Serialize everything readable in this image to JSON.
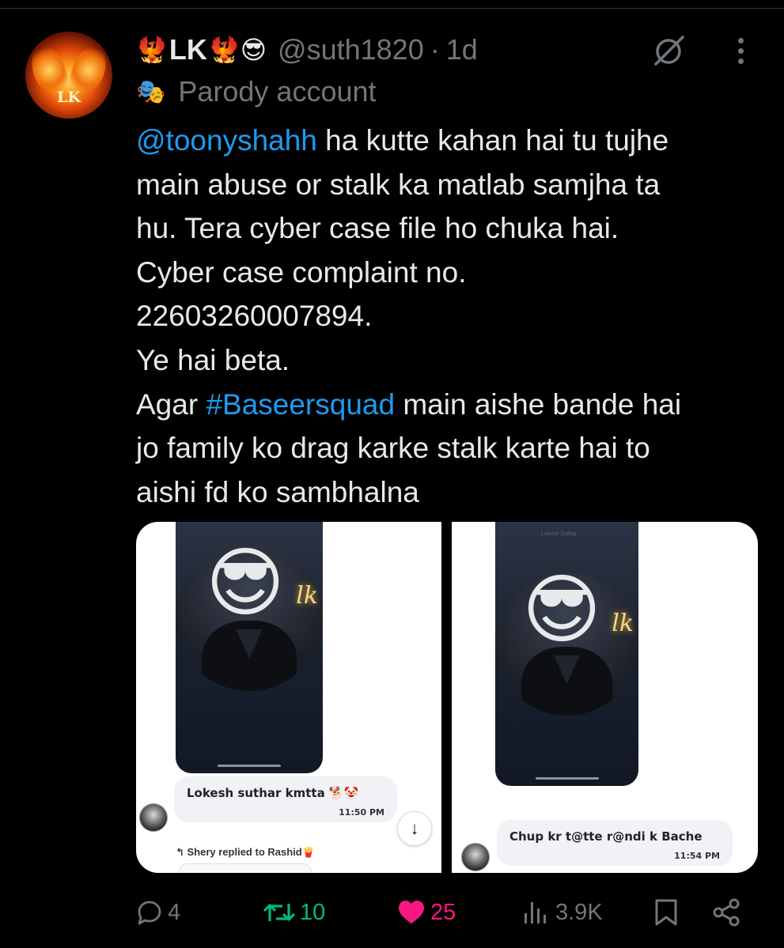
{
  "tweet": {
    "author": {
      "name": "LK",
      "name_prefix_emoji": "🐦‍🔥",
      "name_suffix_emojis": "🐦‍🔥😎",
      "handle": "@suth1820",
      "separator": "·",
      "time": "1d",
      "label_icon": "🎭",
      "label": "Parody account",
      "avatar_monogram": "LK"
    },
    "text": {
      "line1_mention": "@toonyshahh",
      "line1_rest": " ha kutte kahan hai tu tujhe",
      "line2": "main abuse or stalk ka matlab samjha ta",
      "line3": "hu. Tera cyber case file ho chuka hai.",
      "line4": "Cyber case complaint no.",
      "line5": "22603260007894.",
      "line6": "Ye hai beta.",
      "line7_pre": "Agar ",
      "line7_hashtag": "#Baseersquad",
      "line7_post": " main aishe bande hai",
      "line8": "jo family ko drag karke stalk karte hai to",
      "line9": "aishi fd ko sambhalna"
    },
    "media": {
      "image1": {
        "sticker": "😎",
        "signature": "lk",
        "message": "Lokesh suthar kmtta 🐕🤡",
        "timestamp": "11:50 PM",
        "reply_note": "↰ Shery replied to Rashid🍟",
        "scroll_icon": "↓"
      },
      "image2": {
        "sticker": "😎",
        "signature": "lk",
        "faint_text": "Lokesh Suthar",
        "message": "Chup kr t@tte r@ndi k  Bache",
        "timestamp": "11:54 PM"
      }
    },
    "stats": {
      "replies": "4",
      "reposts": "10",
      "likes": "25",
      "views": "3.9K"
    },
    "colors": {
      "background": "#000000",
      "text": "#e7e9ea",
      "muted": "#71767b",
      "link": "#1d9bf0",
      "repost_active": "#00ba7c",
      "like_active": "#f91880"
    },
    "icons": [
      "grok-icon",
      "more-icon",
      "reply-icon",
      "repost-icon",
      "like-icon",
      "views-icon",
      "bookmark-icon",
      "share-icon"
    ]
  }
}
